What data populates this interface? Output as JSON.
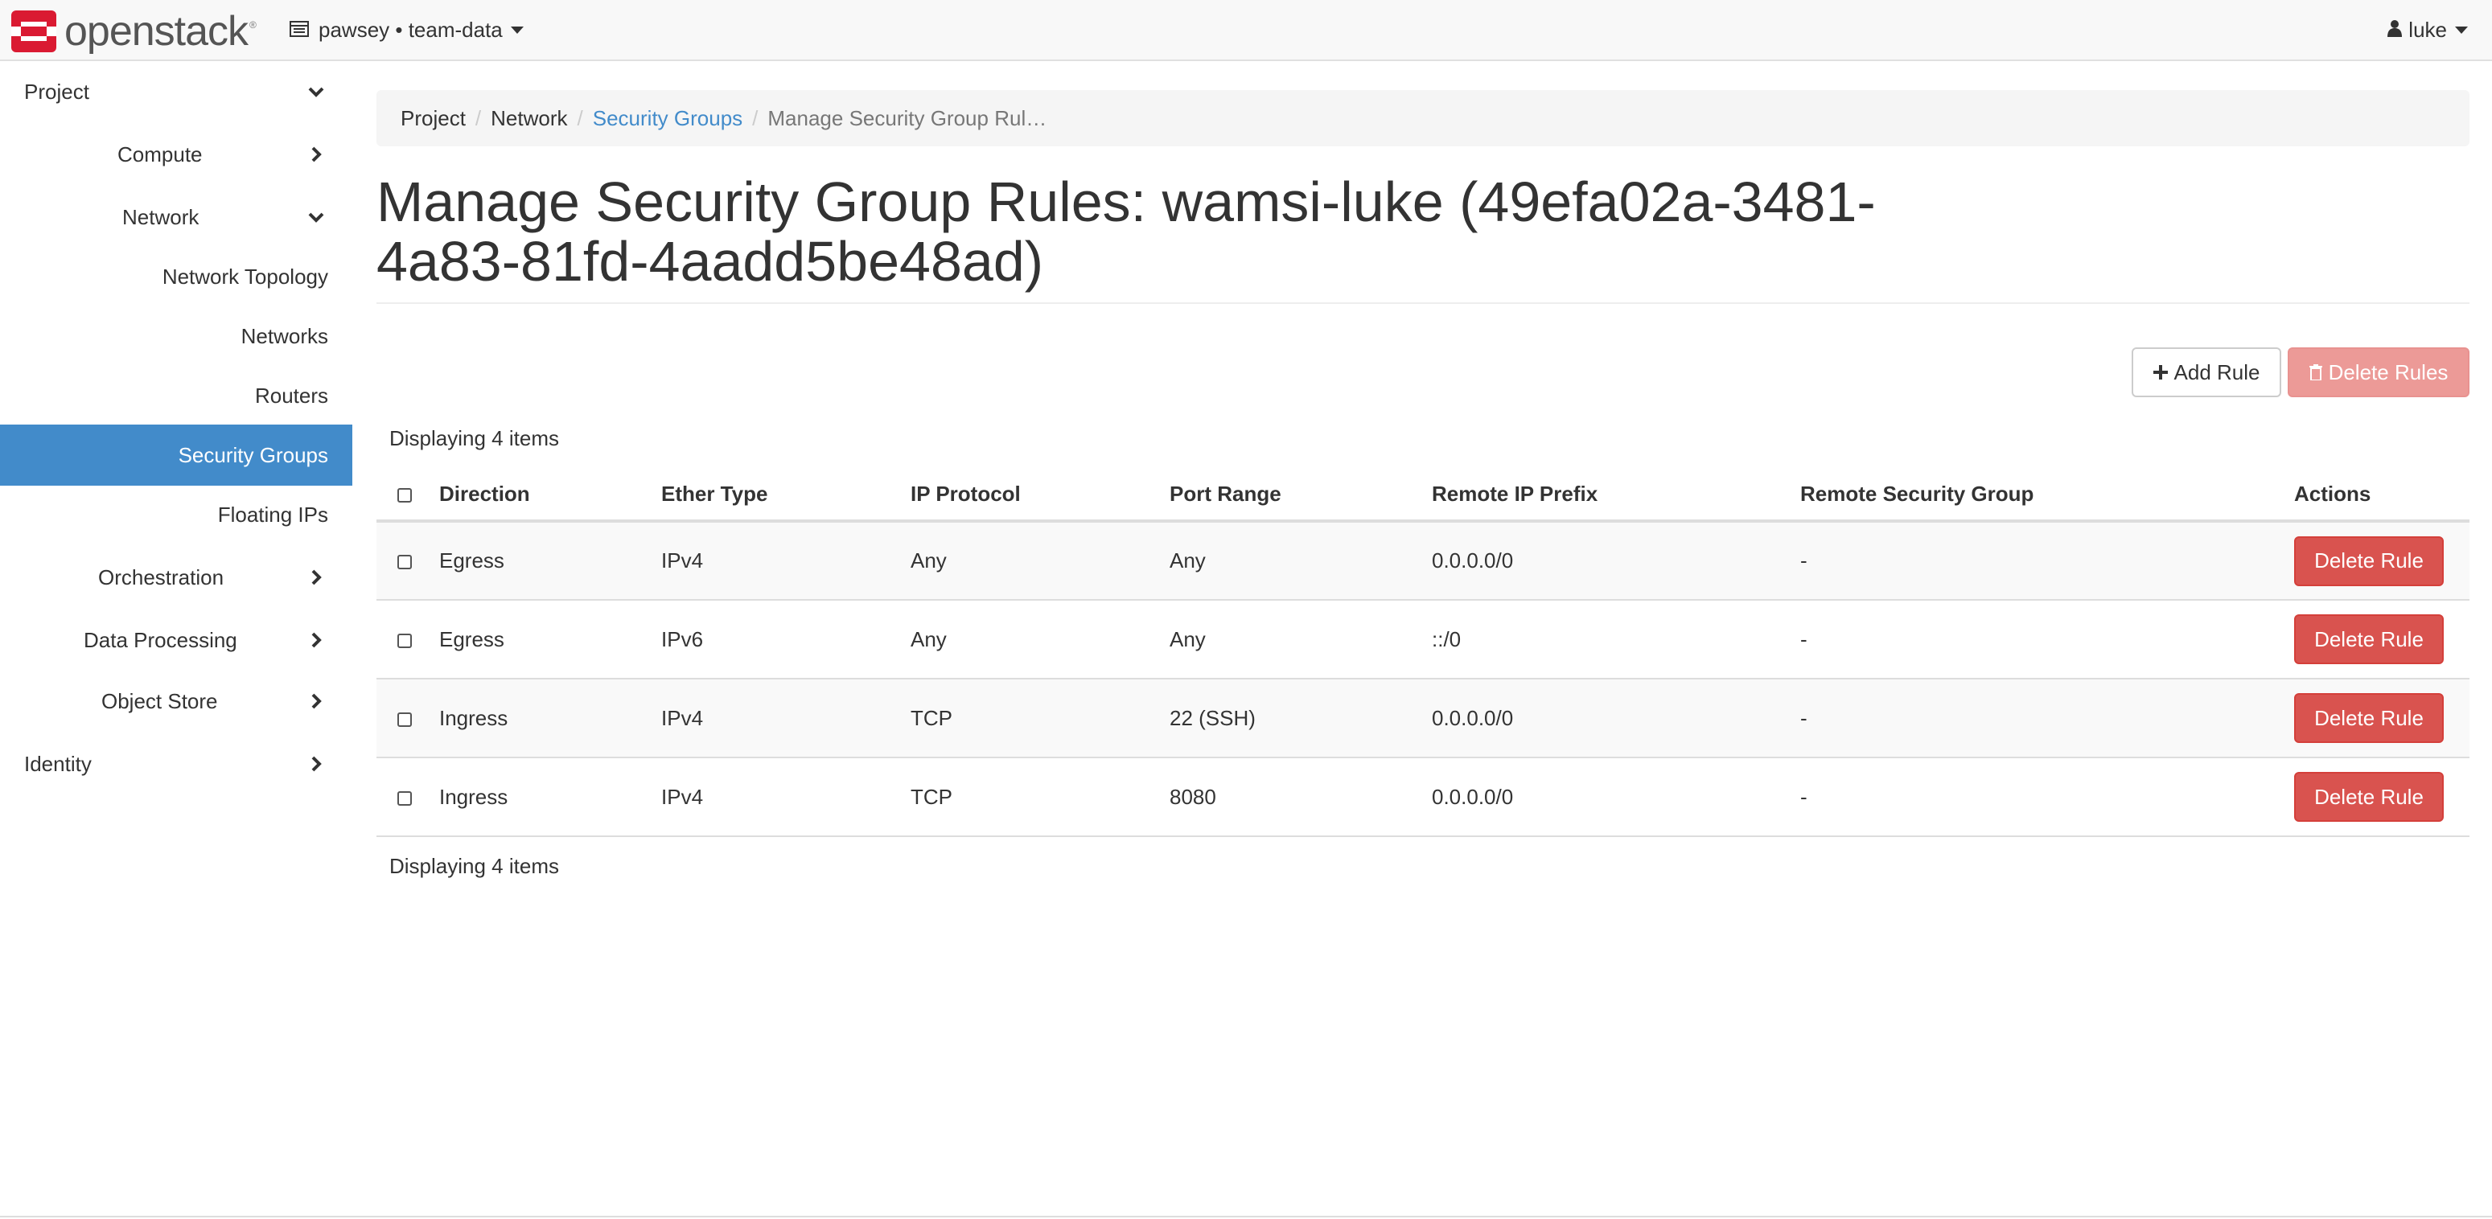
{
  "navbar": {
    "logo_text": "openstack",
    "logo_tm": "®",
    "project_label": "pawsey • team-data",
    "user_label": "luke",
    "brand_color": "#da1a32"
  },
  "sidebar": {
    "project": "Project",
    "compute": "Compute",
    "network": "Network",
    "network_topology": "Network Topology",
    "networks": "Networks",
    "routers": "Routers",
    "security_groups": "Security Groups",
    "floating_ips": "Floating IPs",
    "orchestration": "Orchestration",
    "data_processing": "Data Processing",
    "object_store": "Object Store",
    "identity": "Identity",
    "active_color": "#428bca"
  },
  "breadcrumb": {
    "project": "Project",
    "network": "Network",
    "security_groups": "Security Groups",
    "current": "Manage Security Group Rul…"
  },
  "page": {
    "title_line1": "Manage Security Group Rules: wamsi-luke (49efa02a-3481-",
    "title_line2": "4a83-81fd-4aadd5be48ad)"
  },
  "toolbar": {
    "add_rule": "Add Rule",
    "delete_rules": "Delete Rules"
  },
  "table": {
    "count_label": "Displaying 4 items",
    "columns": [
      "Direction",
      "Ether Type",
      "IP Protocol",
      "Port Range",
      "Remote IP Prefix",
      "Remote Security Group",
      "Actions"
    ],
    "rows": [
      {
        "direction": "Egress",
        "ether_type": "IPv4",
        "ip_protocol": "Any",
        "port_range": "Any",
        "remote_ip_prefix": "0.0.0.0/0",
        "remote_sg": "-",
        "action": "Delete Rule"
      },
      {
        "direction": "Egress",
        "ether_type": "IPv6",
        "ip_protocol": "Any",
        "port_range": "Any",
        "remote_ip_prefix": "::/0",
        "remote_sg": "-",
        "action": "Delete Rule"
      },
      {
        "direction": "Ingress",
        "ether_type": "IPv4",
        "ip_protocol": "TCP",
        "port_range": "22 (SSH)",
        "remote_ip_prefix": "0.0.0.0/0",
        "remote_sg": "-",
        "action": "Delete Rule"
      },
      {
        "direction": "Ingress",
        "ether_type": "IPv4",
        "ip_protocol": "TCP",
        "port_range": "8080",
        "remote_ip_prefix": "0.0.0.0/0",
        "remote_sg": "-",
        "action": "Delete Rule"
      }
    ]
  }
}
